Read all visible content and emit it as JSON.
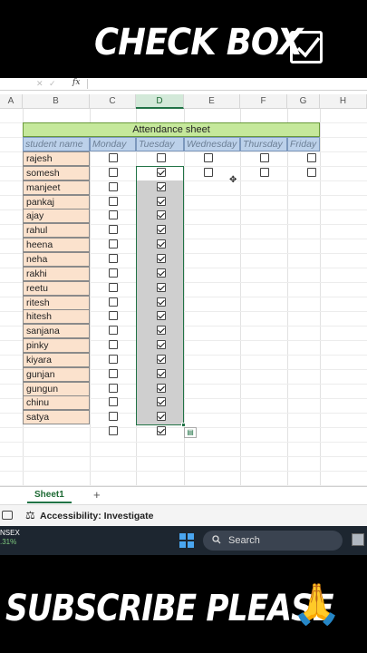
{
  "banner": {
    "title": "CHECK BOX",
    "checkbox_icon": "checked-box-icon"
  },
  "formula_bar": {
    "cell_ref": "",
    "fx_label": "fx",
    "value": ""
  },
  "columns": [
    {
      "label": "A"
    },
    {
      "label": "B"
    },
    {
      "label": "C"
    },
    {
      "label": "D"
    },
    {
      "label": "E"
    },
    {
      "label": "F"
    },
    {
      "label": "G"
    },
    {
      "label": "H"
    }
  ],
  "table": {
    "title": "Attendance  sheet",
    "headers": [
      "student name",
      "Monday",
      "Tuesday",
      "Wednesday",
      "Thursday",
      "Friday"
    ],
    "students": [
      "rajesh",
      "somesh",
      "manjeet",
      "pankaj",
      "ajay",
      "rahul",
      "heena",
      "neha",
      "rakhi",
      "reetu",
      "ritesh",
      "hitesh",
      "sanjana",
      "pinky",
      "kiyara",
      "gunjan",
      "gungun",
      "chinu",
      "satya"
    ]
  },
  "checkbox_state": {
    "monday": "all unchecked",
    "tuesday": "checked from row 2 (somesh) to the last row below satya",
    "wednesday_thursday_friday": "checkboxes only on first two rows, unchecked"
  },
  "sheet_tabs": {
    "active": "Sheet1",
    "add_icon": "plus-icon"
  },
  "status_bar": {
    "accessibility": "Accessibility: Investigate"
  },
  "taskbar": {
    "left_line1": "NSEX",
    "left_line2": ".31%",
    "search_label": "Search"
  },
  "footer": {
    "text": "SUBSCRIBE  PLEASE",
    "emoji": "🙏"
  }
}
